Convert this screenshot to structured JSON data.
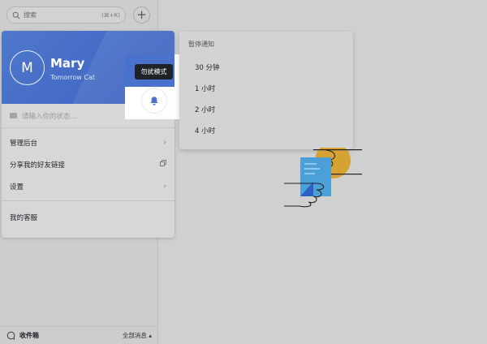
{
  "search": {
    "placeholder": "搜索",
    "shortcut": "(⌘+K)"
  },
  "profile": {
    "avatar_letter": "M",
    "name": "Mary",
    "org": "Tomorrow Cat",
    "status_placeholder": "请输入你的状态..."
  },
  "tooltip": {
    "label": "勿扰模式"
  },
  "menu": {
    "items": [
      {
        "label": "管理后台",
        "icon": "chevron-right-icon"
      },
      {
        "label": "分享我的好友链接",
        "icon": "copy-icon"
      },
      {
        "label": "设置",
        "icon": "chevron-right-icon"
      }
    ],
    "support_label": "我的客服"
  },
  "pause_menu": {
    "title": "暂停通知",
    "options": [
      "30 分钟",
      "1 小时",
      "2 小时",
      "4 小时"
    ]
  },
  "footer": {
    "inbox_label": "收件箱",
    "filter_label": "全部消息 ▴"
  },
  "colors": {
    "accent": "#3f66c6",
    "tooltip_bg": "#1f2329",
    "illus_yellow": "#d6a233",
    "illus_blue": "#4ba0d8"
  }
}
